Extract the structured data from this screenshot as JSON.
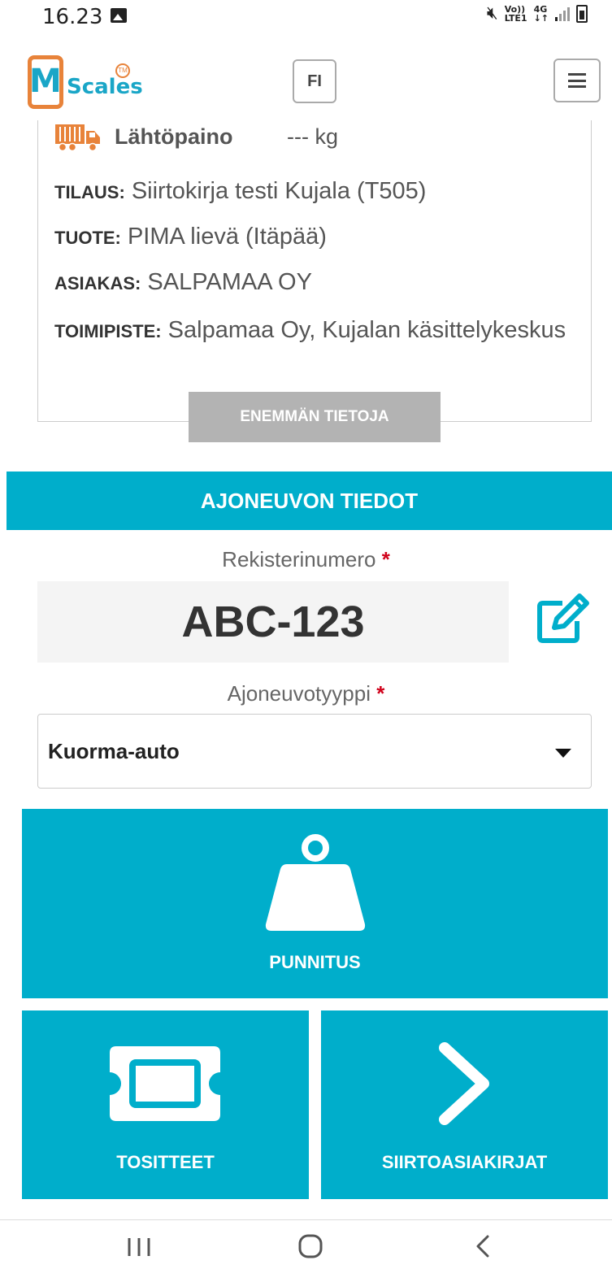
{
  "status_bar": {
    "time": "16.23",
    "network_top": "Vo))",
    "network_bottom": "LTE1",
    "network_type": "4G",
    "icons": [
      "image-icon",
      "mute-icon",
      "signal-icon",
      "battery-icon"
    ]
  },
  "header": {
    "logo_text": "Scales",
    "logo_letter": "M",
    "logo_tm": "TM",
    "language": "FI"
  },
  "info_card": {
    "weight_label": "Lähtöpaino",
    "weight_value": "--- kg",
    "order_label": "TILAUS:",
    "order_value": "Siirtokirja testi Kujala (T505)",
    "product_label": "TUOTE:",
    "product_value": "PIMA lievä (Itäpää)",
    "customer_label": "ASIAKAS:",
    "customer_value": "SALPAMAA OY",
    "site_label": "TOIMIPISTE:",
    "site_value": "Salpamaa Oy, Kujalan käsittelykeskus",
    "more_button": "ENEMMÄN TIETOJA"
  },
  "vehicle": {
    "section_title": "AJONEUVON TIEDOT",
    "plate_label": "Rekisterinumero",
    "plate_value": "ABC-123",
    "type_label": "Ajoneuvotyyppi",
    "type_value": "Kuorma-auto",
    "required_mark": "*"
  },
  "tiles": {
    "weigh": "PUNNITUS",
    "receipts": "TOSITTEET",
    "documents": "SIIRTOASIAKIRJAT"
  },
  "colors": {
    "accent": "#00aecb",
    "brand_orange": "#e8833a",
    "brand_blue": "#1aa6c7",
    "required": "#d0021b",
    "disabled_button": "#b3b3b3"
  }
}
